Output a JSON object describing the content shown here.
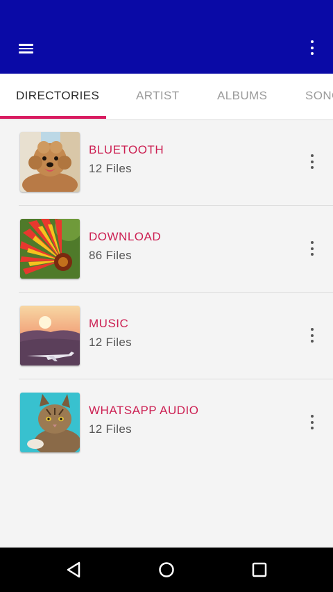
{
  "app_bar": {
    "menu_icon": "hamburger-menu-icon",
    "overflow_icon": "more-vert-icon",
    "background_color": "#0a0aa6"
  },
  "tabs": [
    {
      "label": "DIRECTORIES",
      "active": true
    },
    {
      "label": "ARTIST",
      "active": false
    },
    {
      "label": "ALBUMS",
      "active": false
    },
    {
      "label": "SONGS",
      "active": false
    }
  ],
  "accent_color": "#d81b60",
  "directories": [
    {
      "name": "BLUETOOTH",
      "count": "12 Files",
      "thumbnail": "poodle-dog-photo"
    },
    {
      "name": "DOWNLOAD",
      "count": "86 Files",
      "thumbnail": "red-yellow-flower-photo"
    },
    {
      "name": "MUSIC",
      "count": "12 Files",
      "thumbnail": "sunset-airplane-photo"
    },
    {
      "name": "WHATSAPP AUDIO",
      "count": "12 Files",
      "thumbnail": "tabby-cat-photo"
    }
  ],
  "nav_bar": {
    "back_icon": "back-triangle-icon",
    "home_icon": "home-circle-icon",
    "recents_icon": "recents-square-icon"
  }
}
